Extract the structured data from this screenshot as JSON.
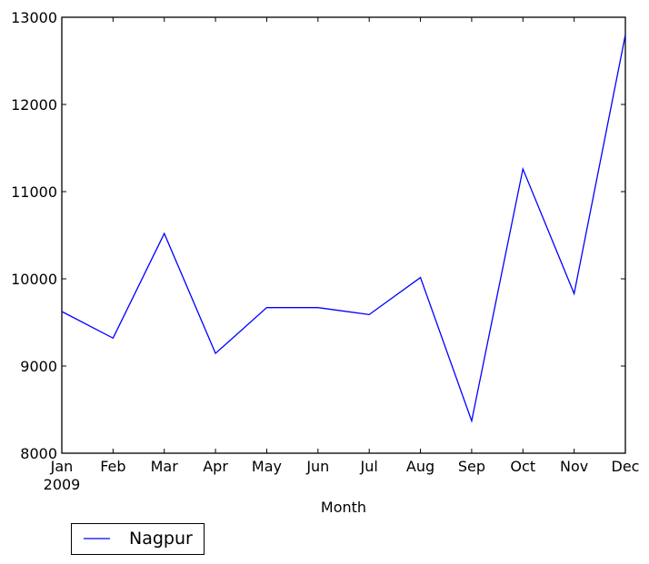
{
  "chart_data": {
    "type": "line",
    "title": "",
    "xlabel": "Month",
    "ylabel": "",
    "categories": [
      "Jan",
      "Feb",
      "Mar",
      "Apr",
      "May",
      "Jun",
      "Jul",
      "Aug",
      "Sep",
      "Oct",
      "Nov",
      "Dec"
    ],
    "x_sublabel": "2009",
    "series": [
      {
        "name": "Nagpur",
        "color": "#0000ff",
        "values": [
          9625,
          9320,
          10520,
          9145,
          9670,
          9670,
          9590,
          10015,
          8370,
          11260,
          9830,
          12800
        ]
      }
    ],
    "ylim": [
      8000,
      13000
    ],
    "yticks": [
      8000,
      9000,
      10000,
      11000,
      12000,
      13000
    ],
    "ytick_labels": [
      "8000",
      "9000",
      "10000",
      "11000",
      "12000",
      "13000"
    ],
    "grid": false,
    "legend": {
      "placement": "below-left",
      "entries": [
        "Nagpur"
      ]
    }
  }
}
